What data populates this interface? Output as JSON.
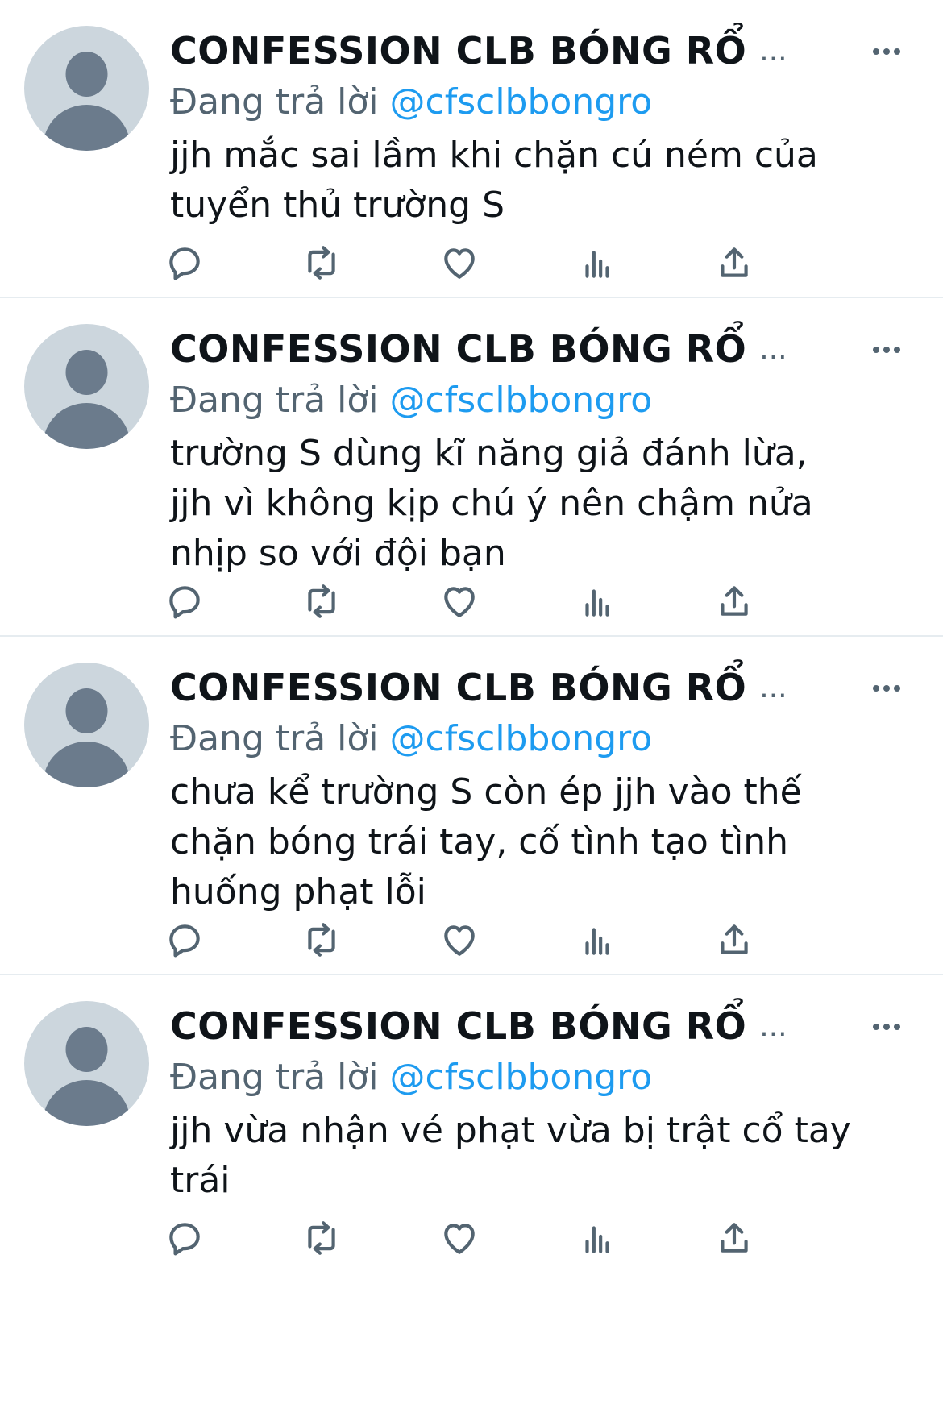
{
  "tweets": [
    {
      "author": "CONFESSION CLB BÓNG RỔ",
      "truncation": "...",
      "replying_prefix": "Đang trả lời",
      "replying_handle": "@cfsclbbongro",
      "text": "jjh mắc sai lầm khi chặn cú ném của\ntuyển thủ trường S"
    },
    {
      "author": "CONFESSION CLB BÓNG RỔ",
      "truncation": "...",
      "replying_prefix": "Đang trả lời",
      "replying_handle": "@cfsclbbongro",
      "text": "trường S dùng kĩ năng giả đánh lừa,\njjh vì không kịp chú ý nên chậm nửa\nnhịp so với đội bạn"
    },
    {
      "author": "CONFESSION CLB BÓNG RỔ",
      "truncation": "...",
      "replying_prefix": "Đang trả lời",
      "replying_handle": "@cfsclbbongro",
      "text": "chưa kể trường S còn ép jjh vào thế\nchặn bóng trái tay, cố tình tạo tình\nhuống phạt lỗi"
    },
    {
      "author": "CONFESSION CLB BÓNG RỔ",
      "truncation": "...",
      "replying_prefix": "Đang trả lời",
      "replying_handle": "@cfsclbbongro",
      "text": "jjh vừa nhận vé phạt vừa bị trật cổ tay\ntrái"
    }
  ],
  "icons": {
    "avatar": "default-avatar-icon",
    "more": "more-horizontal-icon",
    "reply": "reply-icon",
    "retweet": "retweet-icon",
    "like": "heart-icon",
    "views": "views-bar-chart-icon",
    "share": "share-icon"
  },
  "colors": {
    "text": "#0f1419",
    "secondary": "#536471",
    "link": "#1d9bf0",
    "avatar_bg": "#ccd6dd",
    "avatar_fg": "#6b7b8c",
    "divider": "#e6ecf0"
  }
}
